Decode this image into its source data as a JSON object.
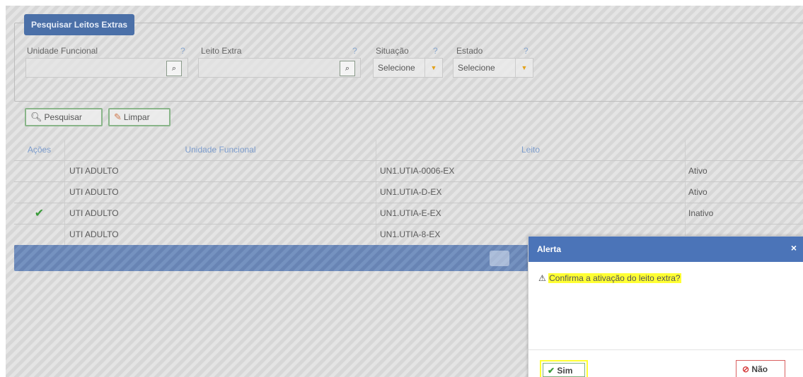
{
  "search_panel": {
    "title": "Pesquisar Leitos Extras",
    "fields": {
      "unidade_funcional": {
        "label": "Unidade Funcional",
        "help": "?",
        "value": ""
      },
      "leito_extra": {
        "label": "Leito Extra",
        "help": "?",
        "value": ""
      },
      "situacao": {
        "label": "Situação",
        "help": "?",
        "selected": "Selecione"
      },
      "estado": {
        "label": "Estado",
        "help": "?",
        "selected": "Selecione"
      }
    },
    "lookup_icon": "magnifier-icon",
    "buttons": {
      "search_label": "Pesquisar",
      "clear_label": "Limpar"
    }
  },
  "table": {
    "columns": [
      "Ações",
      "Unidade Funcional",
      "Leito",
      ""
    ],
    "rows": [
      {
        "action": "",
        "unidade": "UTI ADULTO",
        "leito": "UN1.UTIA-0006-EX",
        "estado": "Ativo"
      },
      {
        "action": "",
        "unidade": "UTI ADULTO",
        "leito": "UN1.UTIA-D-EX",
        "estado": "Ativo"
      },
      {
        "action": "✔",
        "unidade": "UTI ADULTO",
        "leito": "UN1.UTIA-E-EX",
        "estado": "Inativo"
      },
      {
        "action": "",
        "unidade": "UTI ADULTO",
        "leito": "UN1.UTIA-8-EX",
        "estado": ""
      }
    ]
  },
  "dialog": {
    "title": "Alerta",
    "close": "×",
    "warning_icon": "⚠",
    "message": "Confirma a ativação do leito extra?",
    "yes_label": "Sim",
    "no_label": "Não"
  },
  "colors": {
    "accent": "#4b74b8",
    "highlight": "#ffff33",
    "ok_green": "#3a9a3a",
    "danger": "#d43a3a"
  }
}
